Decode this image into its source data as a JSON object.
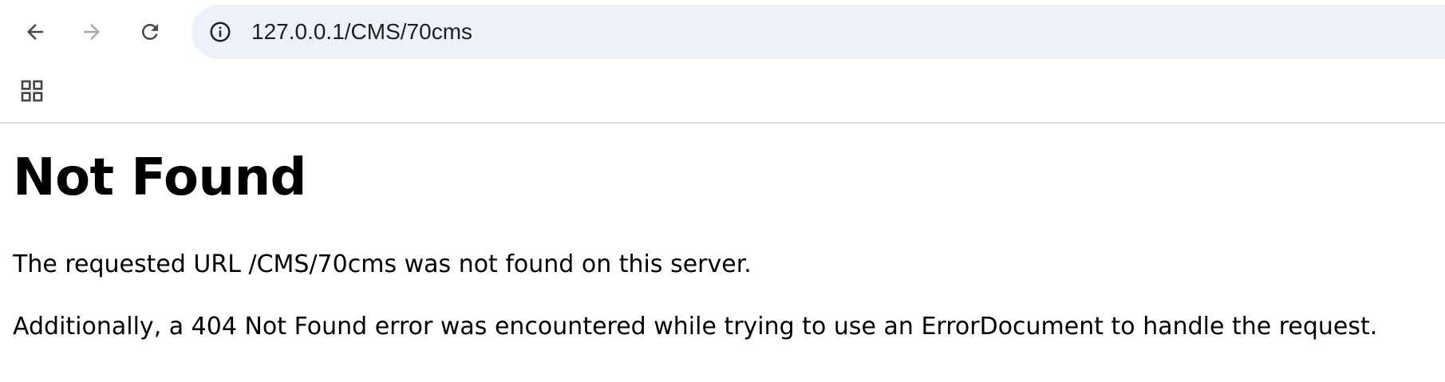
{
  "browser": {
    "url": "127.0.0.1/CMS/70cms",
    "icons": {
      "back": "arrow-left-icon",
      "forward": "arrow-right-icon",
      "reload": "reload-icon",
      "site_info": "info-circle-icon",
      "apps": "apps-grid-icon"
    },
    "colors": {
      "omnibox_bg": "#edf2fa",
      "icon_active": "#474747",
      "icon_disabled": "#a8a8a8"
    }
  },
  "page": {
    "heading": "Not Found",
    "message": "The requested URL /CMS/70cms was not found on this server.",
    "additional": "Additionally, a 404 Not Found error was encountered while trying to use an ErrorDocument to handle the request."
  }
}
